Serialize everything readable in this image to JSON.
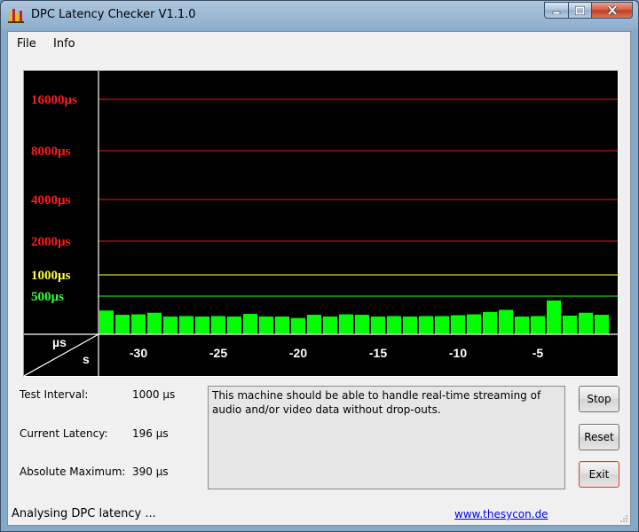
{
  "window": {
    "title": "DPC Latency Checker V1.1.0",
    "icon": "bar-chart-icon",
    "controls": [
      "minimize-icon",
      "maximize-icon",
      "close-icon"
    ]
  },
  "menu": {
    "items": [
      "File",
      "Info"
    ]
  },
  "graph": {
    "y_labels": [
      {
        "text": "16000µs",
        "color": "#ff1a1a"
      },
      {
        "text": "8000µs",
        "color": "#ff1a1a"
      },
      {
        "text": "4000µs",
        "color": "#ff1a1a"
      },
      {
        "text": "2000µs",
        "color": "#ff1a1a"
      },
      {
        "text": "1000µs",
        "color": "#ffff33"
      },
      {
        "text": "500µs",
        "color": "#33ff33"
      }
    ],
    "corner_top": "µs",
    "corner_bottom": "s",
    "x_labels": [
      "-30",
      "-25",
      "-20",
      "-15",
      "-10",
      "-5"
    ]
  },
  "chart_data": {
    "type": "bar",
    "title": "",
    "xlabel": "s",
    "ylabel": "µs",
    "y_scale": "log2",
    "y_ticks": [
      500,
      1000,
      2000,
      4000,
      8000,
      16000
    ],
    "x_ticks": [
      -30,
      -25,
      -20,
      -15,
      -10,
      -5
    ],
    "x": [
      -32,
      -31,
      -30,
      -29,
      -28,
      -27,
      -26,
      -25,
      -24,
      -23,
      -22,
      -21,
      -20,
      -19,
      -18,
      -17,
      -16,
      -15,
      -14,
      -13,
      -12,
      -11,
      -10,
      -9,
      -8,
      -7,
      -6,
      -5,
      -4,
      -3,
      -2,
      -1
    ],
    "values": [
      205,
      150,
      155,
      175,
      130,
      135,
      130,
      135,
      130,
      160,
      130,
      130,
      115,
      150,
      130,
      155,
      150,
      130,
      135,
      130,
      135,
      135,
      145,
      155,
      185,
      215,
      130,
      135,
      390,
      140,
      175,
      150
    ],
    "bar_color": "#00ff00"
  },
  "info": {
    "test_interval_label": "Test Interval:",
    "test_interval_value": "1000 µs",
    "current_latency_label": "Current Latency:",
    "current_latency_value": "196 µs",
    "absolute_maximum_label": "Absolute Maximum:",
    "absolute_maximum_value": "390 µs",
    "message": "This machine should be able to handle real-time streaming of audio and/or video data without drop-outs."
  },
  "buttons": {
    "stop": "Stop",
    "reset": "Reset",
    "exit": "Exit"
  },
  "status": {
    "text": "Analysing DPC latency ...",
    "link": "www.thesycon.de"
  }
}
